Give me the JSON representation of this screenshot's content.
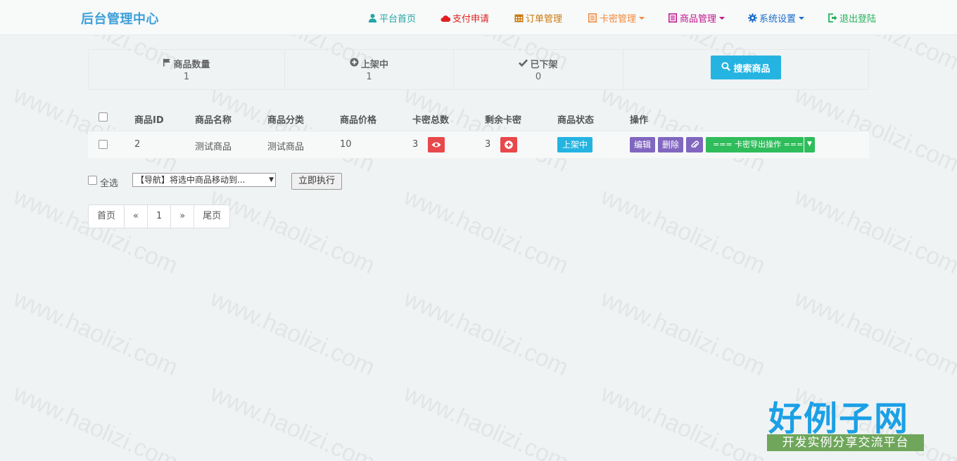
{
  "brand": "后台管理中心",
  "nav": [
    {
      "label": "平台首页",
      "icon": "user-icon",
      "color": "#25a4a4"
    },
    {
      "label": "支付申请",
      "icon": "cloud-icon",
      "color": "#e02020"
    },
    {
      "label": "订单管理",
      "icon": "calendar-icon",
      "color": "#c97a10"
    },
    {
      "label": "卡密管理",
      "icon": "list-icon",
      "color": "#f0883a"
    },
    {
      "label": "商品管理",
      "icon": "list-icon",
      "color": "#c0138c"
    },
    {
      "label": "系统设置",
      "icon": "gear-icon",
      "color": "#1a6cc9"
    },
    {
      "label": "退出登陆",
      "icon": "logout-icon",
      "color": "#27b35e"
    }
  ],
  "stats": [
    {
      "label": "商品数量",
      "value": "1",
      "icon": "flag-icon"
    },
    {
      "label": "上架中",
      "value": "1",
      "icon": "plus-circle-icon"
    },
    {
      "label": "已下架",
      "value": "0",
      "icon": "check-icon"
    }
  ],
  "search_button": "搜索商品",
  "table": {
    "headers": [
      "商品ID",
      "商品名称",
      "商品分类",
      "商品价格",
      "卡密总数",
      "剩余卡密",
      "商品状态",
      "操作"
    ],
    "rows": [
      {
        "id": "2",
        "name": "测试商品",
        "category": "测试商品",
        "price": "10",
        "total_cards": "3",
        "remaining_cards": "3",
        "status": "上架中",
        "edit": "编辑",
        "delete": "删除",
        "export_select": "=== 卡密导出操作 ==="
      }
    ]
  },
  "bulk": {
    "select_all": "全选",
    "move_select": "【导航】将选中商品移动到...",
    "execute": "立即执行"
  },
  "pagination": [
    "首页",
    "«",
    "1",
    "»",
    "尾页"
  ],
  "watermark": "www.haolizi.com",
  "logo": {
    "title": "好例子网",
    "subtitle": "开发实例分享交流平台"
  },
  "colors": {
    "accent": "#25b4e2",
    "danger": "#e8484b",
    "purple": "#8166c0",
    "green": "#2fbd5b"
  }
}
